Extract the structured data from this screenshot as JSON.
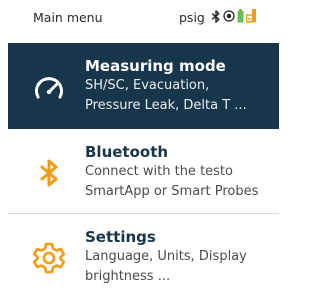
{
  "statusbar": {
    "title": "Main menu",
    "unit": "psig",
    "icons": [
      "bluetooth-icon",
      "record-icon",
      "battery-icon",
      "probe-icon"
    ],
    "colors": {
      "battery": "#6cc04a",
      "probe": "#f39c12",
      "text": "#2a2a2a"
    }
  },
  "menu": {
    "items": [
      {
        "title": "Measuring mode",
        "desc_line1": "SH/SC, Evacuation,",
        "desc_line2": "Pressure Leak, Delta T ...",
        "icon": "gauge-icon",
        "active": true
      },
      {
        "title": "Bluetooth",
        "desc_line1": "Connect with the testo",
        "desc_line2": "SmartApp or Smart Probes",
        "icon": "bluetooth-icon",
        "active": false
      },
      {
        "title": "Settings",
        "desc_line1": "Language, Units, Display",
        "desc_line2": "brightness ...",
        "icon": "gear-icon",
        "active": false
      }
    ]
  },
  "colors": {
    "active_bg": "#17364c",
    "title": "#17364c",
    "accent": "#f39c12",
    "divider": "#d9d9d9"
  }
}
